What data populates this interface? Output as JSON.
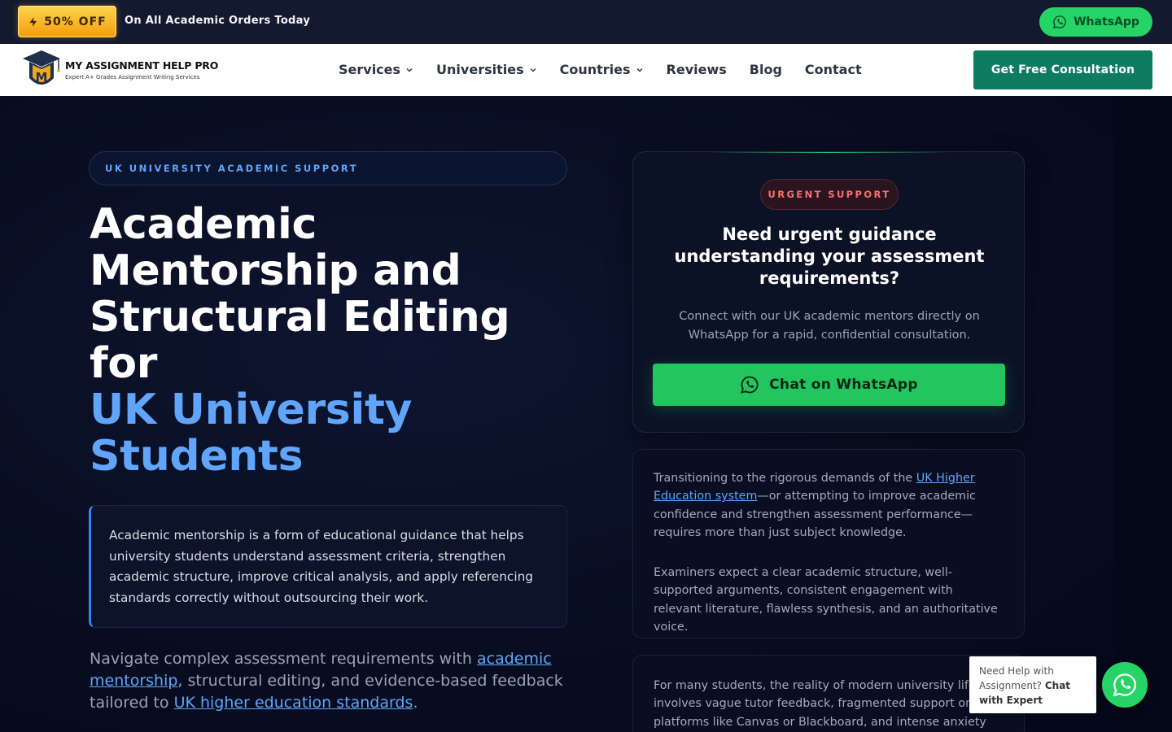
{
  "promo": {
    "badge": "50% OFF",
    "text": "On All Academic Orders Today",
    "whatsapp_label": "WhatsApp"
  },
  "nav": {
    "logo_title": "MY ASSIGNMENT HELP PRO",
    "logo_subtitle": "Expert A+ Grades Assignment Writing Services",
    "links": [
      {
        "label": "Services",
        "dropdown": true
      },
      {
        "label": "Universities",
        "dropdown": true
      },
      {
        "label": "Countries",
        "dropdown": true
      },
      {
        "label": "Reviews",
        "dropdown": false
      },
      {
        "label": "Blog",
        "dropdown": false
      },
      {
        "label": "Contact",
        "dropdown": false
      }
    ],
    "cta": "Get Free Consultation"
  },
  "hero": {
    "kicker": "UK UNIVERSITY ACADEMIC SUPPORT",
    "title_main": "Academic Mentorship and Structural Editing for",
    "title_accent": "UK University Students",
    "definition": "Academic mentorship is a form of educational guidance that helps university students understand assessment criteria, strengthen academic structure, improve critical analysis, and apply referencing standards correctly without outsourcing their work.",
    "lead_pre": "Navigate complex assessment requirements with ",
    "lead_link1": "academic mentorship",
    "lead_mid": ", structural editing, and evidence-based feedback tailored to ",
    "lead_link2": "UK higher education standards",
    "lead_post": "."
  },
  "urgent": {
    "pill": "URGENT SUPPORT",
    "title": "Need urgent guidance understanding your assessment requirements?",
    "description": "Connect with our UK academic mentors directly on WhatsApp for a rapid, confidential consultation.",
    "button": "Chat on WhatsApp"
  },
  "card1": {
    "p1_pre": "Transitioning to the rigorous demands of the ",
    "p1_link": "UK Higher Education system",
    "p1_post": "—or attempting to improve academic confidence and strengthen assessment performance—requires more than just subject knowledge.",
    "p2": "Examiners expect a clear academic structure, well-supported arguments, consistent engagement with relevant literature, flawless synthesis, and an authoritative voice."
  },
  "card2": {
    "p1": "For many students, the reality of modern university life involves vague tutor feedback, fragmented support on platforms like Canvas or Blackboard, and intense anxiety"
  },
  "help": {
    "line1": "Need Help with Assignment? ",
    "bold": "Chat with Expert"
  },
  "colors": {
    "accent_blue": "#60a5fa",
    "whatsapp_green": "#25d366",
    "consult_green": "#0e7b63",
    "promo_gold": "#f59e0b"
  }
}
